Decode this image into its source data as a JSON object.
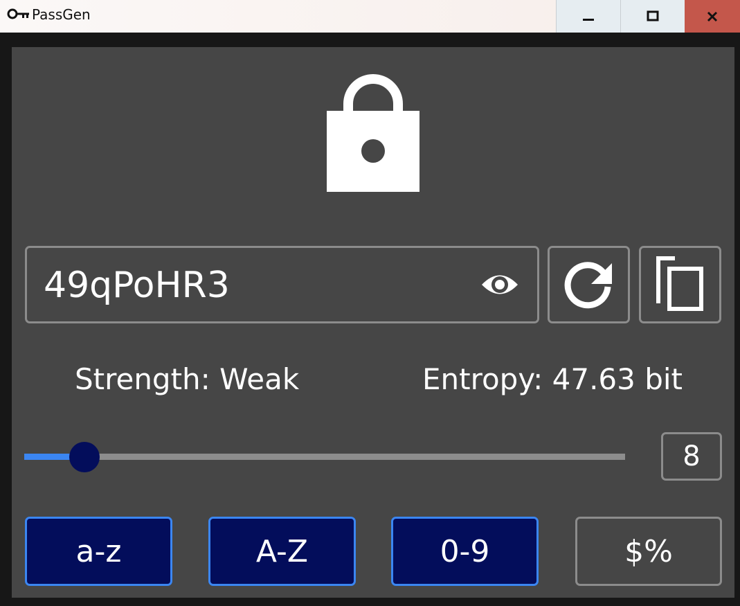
{
  "window": {
    "title": "PassGen",
    "icon": "key-icon",
    "controls": [
      "minimize-icon",
      "maximize-icon",
      "close-icon"
    ]
  },
  "header": {
    "icon": "lock-icon"
  },
  "password": {
    "value": "49qPoHR3",
    "show_icon": "eye-icon",
    "regenerate_icon": "refresh-icon",
    "copy_icon": "copy-icon"
  },
  "stats": {
    "strength": "Strength: Weak",
    "entropy": "Entropy: 47.63 bit"
  },
  "length": {
    "value": "8",
    "slider_fraction": 0.1
  },
  "charsets": [
    {
      "label": "a-z",
      "active": true
    },
    {
      "label": "A-Z",
      "active": true
    },
    {
      "label": "0-9",
      "active": true
    },
    {
      "label": "$%",
      "active": false
    }
  ],
  "colors": {
    "panel": "#464646",
    "accent": "#3b86f2",
    "active": "#030d5b",
    "close": "#c4574b"
  }
}
